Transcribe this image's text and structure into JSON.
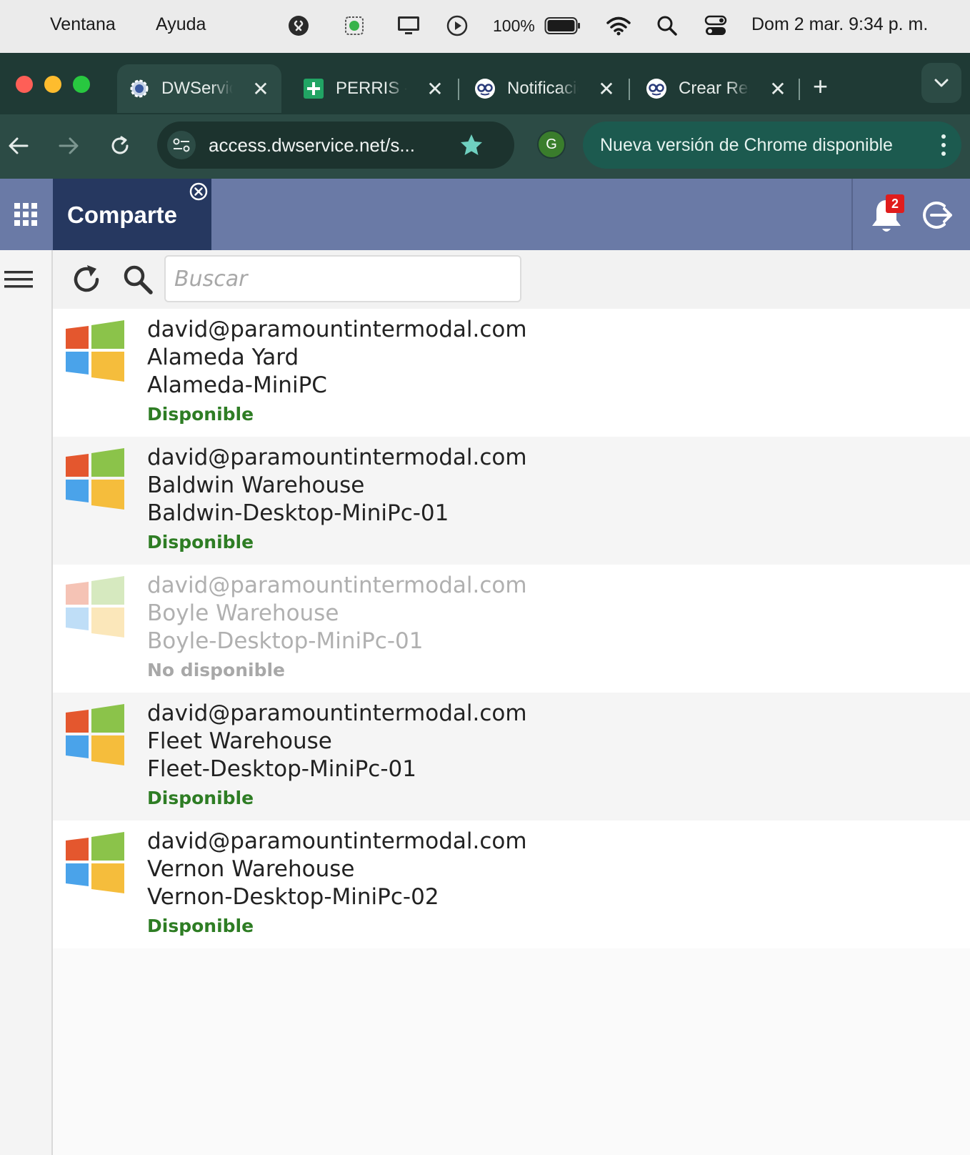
{
  "menubar": {
    "items": [
      "Ventana",
      "Ayuda"
    ],
    "battery": "100%",
    "clock": "Dom 2 mar.  9:34 p. m.",
    "icons": [
      "shazam-icon",
      "cpu-chip-icon",
      "display-icon",
      "play-circle-icon",
      "battery-icon",
      "wifi-icon",
      "spotlight-search-icon",
      "control-center-icon"
    ]
  },
  "browser": {
    "tabs": [
      {
        "title": "DWService",
        "icon": "dwservice-gear-icon",
        "active": true
      },
      {
        "title": "PERRIS - ",
        "icon": "sheets-plus-icon",
        "active": false
      },
      {
        "title": "Notificaciones",
        "icon": "glasses-face-icon",
        "active": false
      },
      {
        "title": "Crear Reporte",
        "icon": "glasses-face-icon",
        "active": false
      }
    ],
    "close_glyph": "✕",
    "newtab_glyph": "+",
    "url": "access.dwservice.net/s...",
    "profile_initial": "G",
    "update_text": "Nueva versión de Chrome disponible"
  },
  "app": {
    "tab_label": "Comparte",
    "notification_count": "2",
    "search_placeholder": "Buscar"
  },
  "devices": [
    {
      "user": "david@paramountintermodal.com",
      "group": "Alameda Yard",
      "name": "Alameda-MiniPC",
      "status": "Disponible",
      "online": true
    },
    {
      "user": "david@paramountintermodal.com",
      "group": "Baldwin Warehouse",
      "name": "Baldwin-Desktop-MiniPc-01",
      "status": "Disponible",
      "online": true
    },
    {
      "user": "david@paramountintermodal.com",
      "group": "Boyle Warehouse",
      "name": "Boyle-Desktop-MiniPc-01",
      "status": "No disponible",
      "online": false
    },
    {
      "user": "david@paramountintermodal.com",
      "group": "Fleet Warehouse",
      "name": "Fleet-Desktop-MiniPc-01",
      "status": "Disponible",
      "online": true
    },
    {
      "user": "david@paramountintermodal.com",
      "group": "Vernon Warehouse",
      "name": "Vernon-Desktop-MiniPc-02",
      "status": "Disponible",
      "online": true
    }
  ],
  "colors": {
    "chrome_dark": "#1f3a35",
    "chrome_toolbar": "#2c4b45",
    "header_blue": "#6a7aa6",
    "header_tab": "#263860",
    "status_green": "#2e7d24",
    "status_gray": "#a8a8a8",
    "win_red": "#e4572e",
    "win_green": "#8bc34a",
    "win_blue": "#4aa3ea",
    "win_yellow": "#f5bd3c"
  }
}
